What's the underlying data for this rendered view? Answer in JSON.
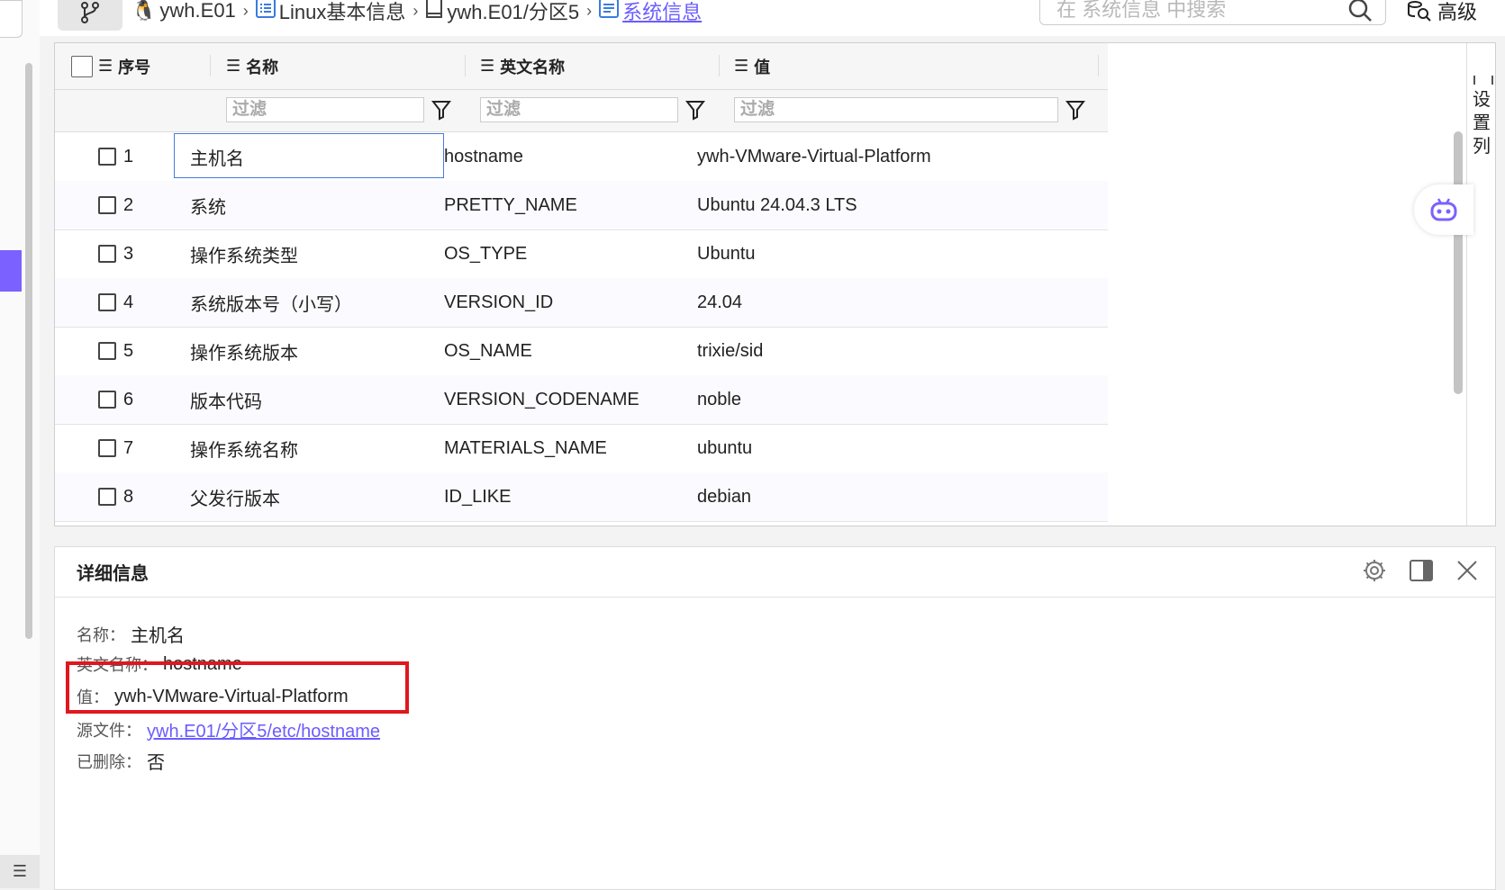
{
  "breadcrumb": {
    "items": [
      {
        "label": "ywh.E01",
        "icon": "linux-penguin-icon"
      },
      {
        "label": "Linux基本信息",
        "icon": "list-document-icon"
      },
      {
        "label": "ywh.E01/分区5",
        "icon": "partition-icon"
      },
      {
        "label": "系统信息",
        "icon": "info-document-icon"
      }
    ]
  },
  "search": {
    "placeholder": "在 系统信息 中搜索"
  },
  "advanced": {
    "label": "高级"
  },
  "table": {
    "headers": [
      "序号",
      "名称",
      "英文名称",
      "值"
    ],
    "filter_placeholder": "过滤",
    "rows": [
      {
        "idx": "1",
        "name": "主机名",
        "en": "hostname",
        "value": "ywh-VMware-Virtual-Platform"
      },
      {
        "idx": "2",
        "name": "系统",
        "en": "PRETTY_NAME",
        "value": "Ubuntu 24.04.3 LTS"
      },
      {
        "idx": "3",
        "name": "操作系统类型",
        "en": "OS_TYPE",
        "value": "Ubuntu"
      },
      {
        "idx": "4",
        "name": "系统版本号（小写）",
        "en": "VERSION_ID",
        "value": "24.04"
      },
      {
        "idx": "5",
        "name": "操作系统版本",
        "en": "OS_NAME",
        "value": "trixie/sid"
      },
      {
        "idx": "6",
        "name": "版本代码",
        "en": "VERSION_CODENAME",
        "value": "noble"
      },
      {
        "idx": "7",
        "name": "操作系统名称",
        "en": "MATERIALS_NAME",
        "value": "ubuntu"
      },
      {
        "idx": "8",
        "name": "父发行版本",
        "en": "ID_LIKE",
        "value": "debian"
      }
    ],
    "settings_label": "设置列"
  },
  "detail": {
    "title": "详细信息",
    "name_label": "名称：",
    "name_value": "主机名",
    "en_label": "英文名称：",
    "en_value": "hostname",
    "value_label": "值：",
    "value_value": "ywh-VMware-Virtual-Platform",
    "source_label": "源文件：",
    "source_value": "ywh.E01/分区5/etc/hostname",
    "deleted_label": "已删除：",
    "deleted_value": "否"
  },
  "colors": {
    "accent": "#6a5cff",
    "highlight": "#e0171d"
  }
}
